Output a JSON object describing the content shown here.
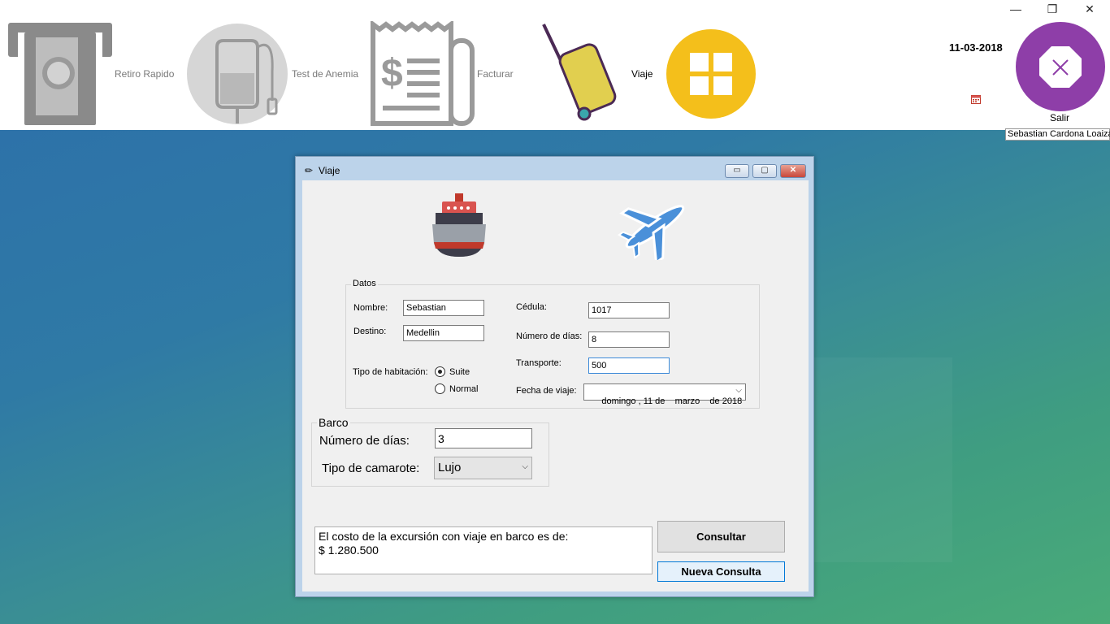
{
  "toolbar": {
    "items": [
      {
        "label": "Retiro Rapido",
        "icon": "atm-icon"
      },
      {
        "label": "Test de Anemia",
        "icon": "iv-bag-icon"
      },
      {
        "label": "Facturar",
        "icon": "invoice-icon"
      },
      {
        "label": "Viaje",
        "icon": "luggage-icon"
      }
    ],
    "apps_icon": "grid-apps-icon",
    "date": "11-03-2018",
    "calendar_icon": "calendar-icon",
    "exit_label": "Salir",
    "user": "Sebastian Cardona Loaiza",
    "window_controls": {
      "minimize": "—",
      "restore": "❐",
      "close": "✕"
    }
  },
  "dialog": {
    "title": "Viaje",
    "ship_icon": "ship-icon",
    "plane_icon": "airplane-icon",
    "datos": {
      "title": "Datos",
      "nombre_label": "Nombre:",
      "nombre": "Sebastian",
      "destino_label": "Destino:",
      "destino": "Medellin",
      "cedula_label": "Cédula:",
      "cedula": "1017",
      "dias_label": "Número de días:",
      "dias": "8",
      "transporte_label": "Transporte:",
      "transporte": "500",
      "tipo_label": "Tipo de habitación:",
      "suite_label": "Suite",
      "normal_label": "Normal",
      "selected_room": "Suite",
      "fecha_label": "Fecha de viaje:",
      "fecha": "domingo , 11 de    marzo    de 2018"
    },
    "barco": {
      "title": "Barco",
      "dias_label": "Número de días:",
      "dias": "3",
      "camarote_label": "Tipo de camarote:",
      "camarote": "Lujo"
    },
    "result_line1": "El costo de la excursión con viaje en barco es de:",
    "result_line2": "$ 1.280.500",
    "consultar_label": "Consultar",
    "nueva_label": "Nueva Consulta"
  },
  "colors": {
    "apps_yellow": "#f4bf1b",
    "exit_purple": "#8e3ea8",
    "luggage_yellow": "#e1cf4f",
    "primary_border": "#0078d7"
  }
}
